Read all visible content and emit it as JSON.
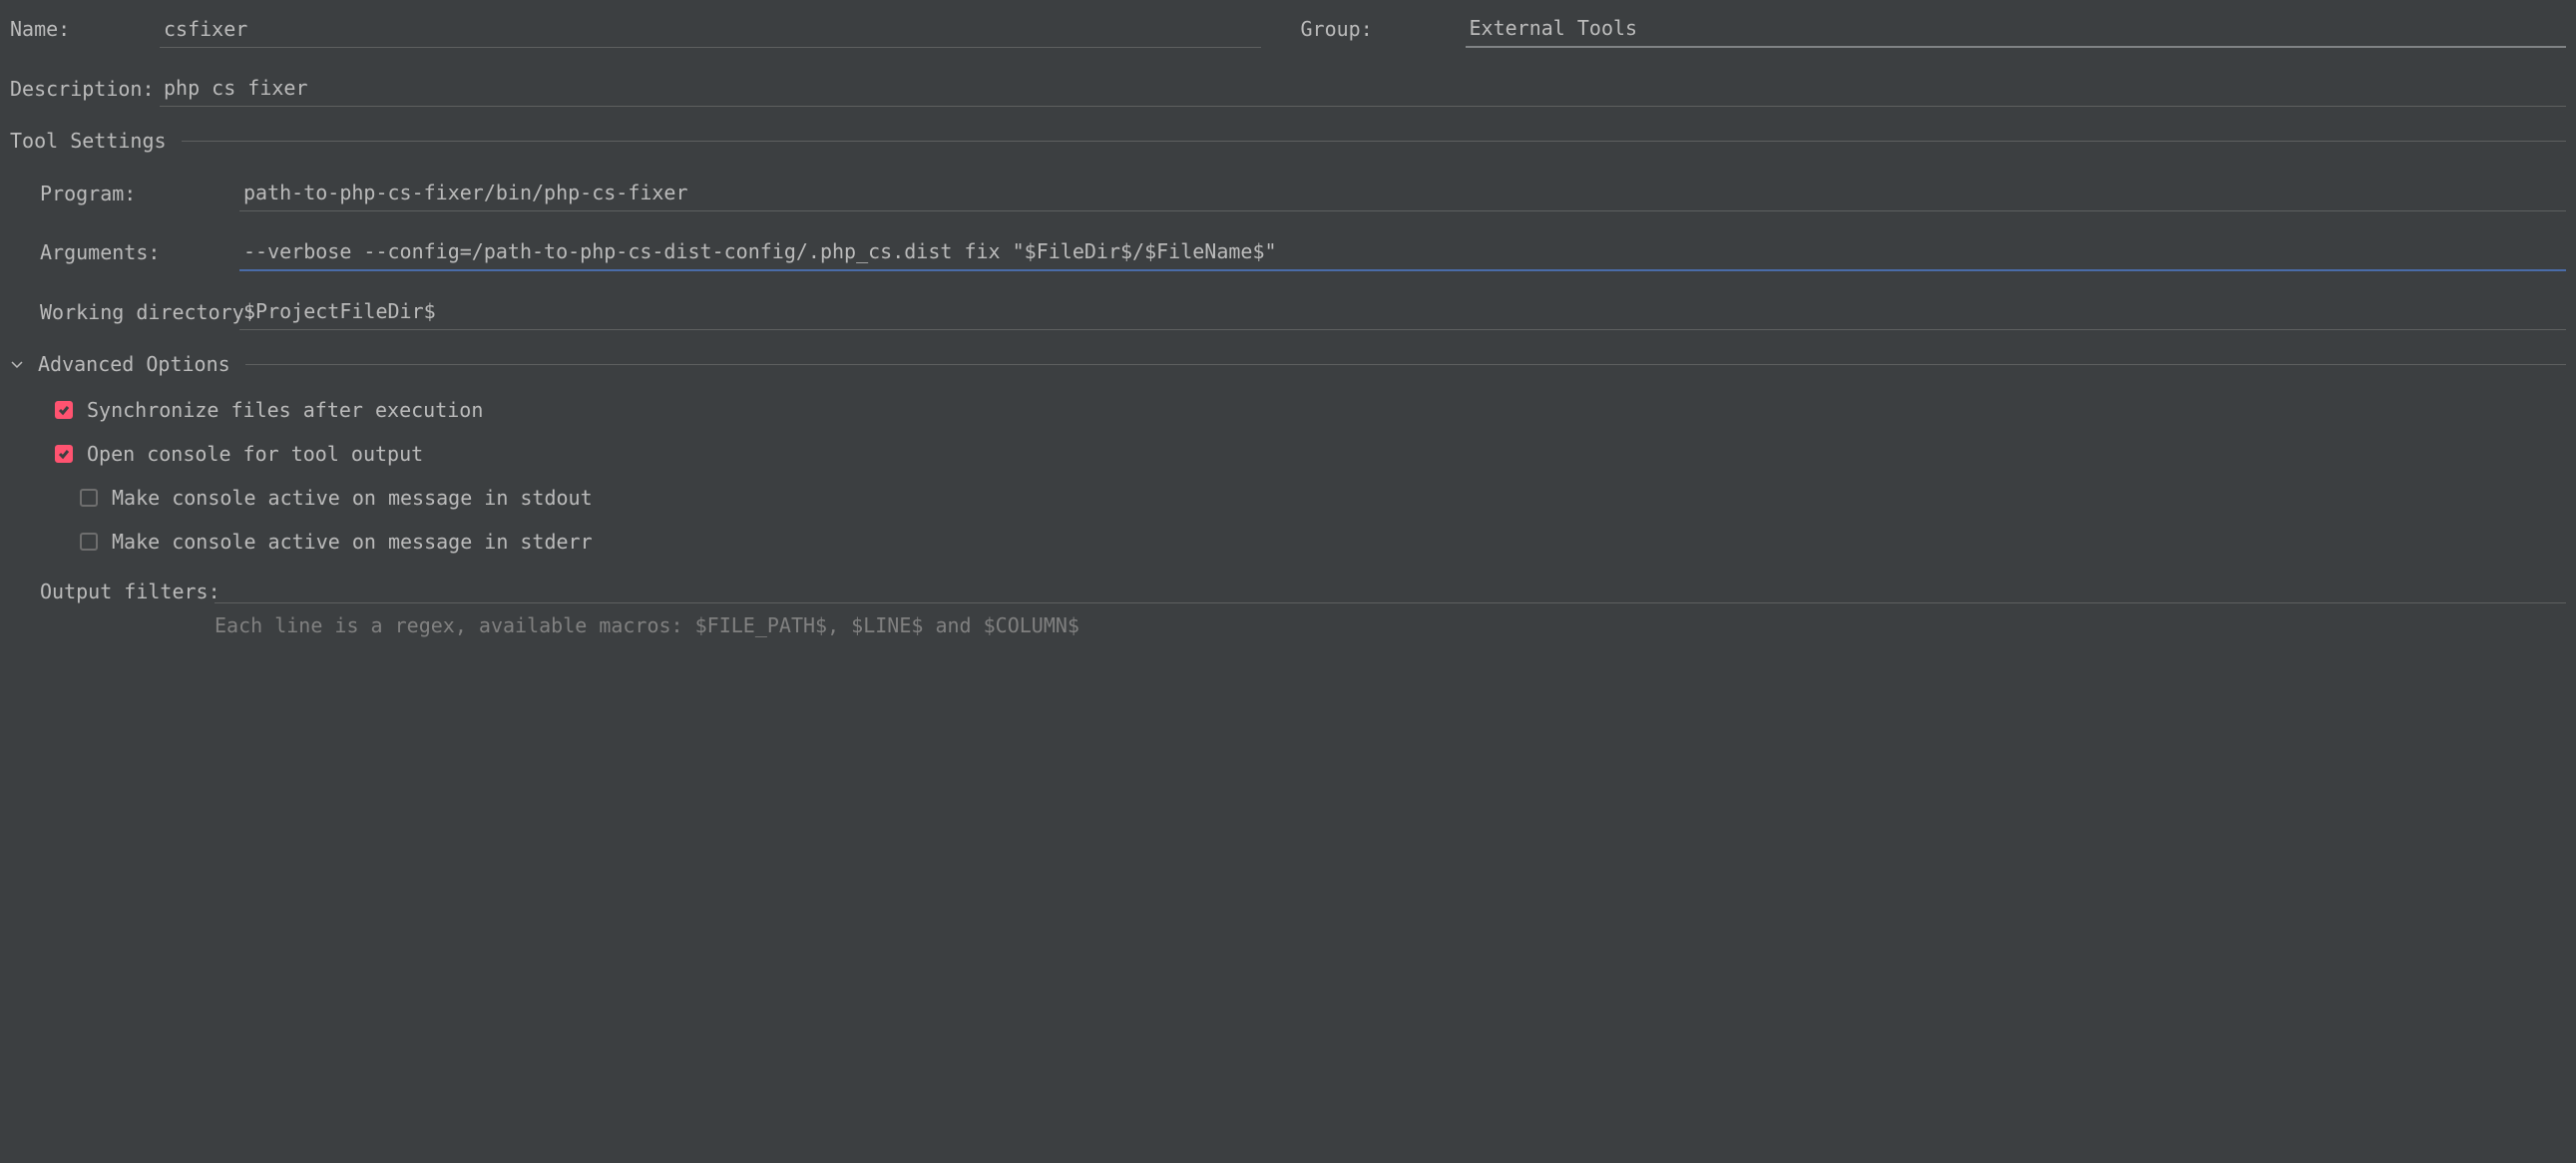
{
  "labels": {
    "name": "Name:",
    "group": "Group:",
    "description": "Description:",
    "tool_settings": "Tool Settings",
    "program": "Program:",
    "arguments": "Arguments:",
    "working_directory": "Working directory:",
    "advanced_options": "Advanced Options",
    "output_filters": "Output filters:"
  },
  "values": {
    "name": "csfixer",
    "group": "External Tools",
    "description": "php cs fixer",
    "program": "path-to-php-cs-fixer/bin/php-cs-fixer",
    "arguments": "--verbose --config=/path-to-php-cs-dist-config/.php_cs.dist fix \"$FileDir$/$FileName$\"",
    "working_directory": "$ProjectFileDir$",
    "output_filters": ""
  },
  "checkboxes": {
    "sync_files": {
      "label": "Synchronize files after execution",
      "checked": true
    },
    "open_console": {
      "label": "Open console for tool output",
      "checked": true
    },
    "stdout_active": {
      "label": "Make console active on message in stdout",
      "checked": false
    },
    "stderr_active": {
      "label": "Make console active on message in stderr",
      "checked": false
    }
  },
  "hint": "Each line is a regex, available macros: $FILE_PATH$, $LINE$ and $COLUMN$"
}
